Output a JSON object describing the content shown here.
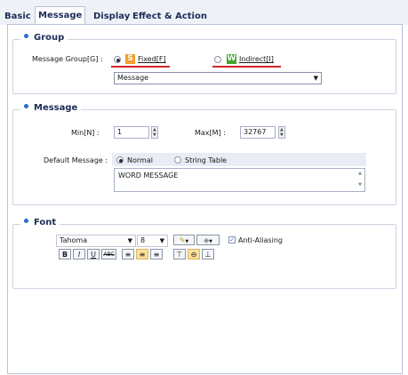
{
  "tabs": [
    {
      "label": "Basic"
    },
    {
      "label": "Message"
    },
    {
      "label": "Display"
    },
    {
      "label": "Effect & Action"
    }
  ],
  "group": {
    "title": "Group",
    "message_group_label": "Message Group[G] :",
    "fixed_label": "Fixed[F]",
    "fixed_badge": "S",
    "indirect_label": "Indirect[I]",
    "indirect_badge": "W",
    "selected_option": "Fixed",
    "dropdown_value": "Message"
  },
  "message": {
    "title": "Message",
    "min_label": "Min[N] :",
    "min_value": "1",
    "max_label": "Max[M] :",
    "max_value": "32767",
    "default_message_label": "Default Message :",
    "normal_label": "Normal",
    "string_table_label": "String Table",
    "selected_option": "Normal",
    "text_value": "WORD MESSAGE"
  },
  "font": {
    "title": "Font",
    "font_name": "Tahoma",
    "font_size": "8",
    "anti_aliasing_label": "Anti-Aliasing",
    "anti_aliasing_checked": true,
    "buttons": {
      "bold": "B",
      "italic": "I",
      "underline": "U",
      "strike": "ABC"
    }
  },
  "colors": {
    "accent": "#2a6bd6",
    "red_underline": "#d12424",
    "fixed_badge": "#f0a030",
    "indirect_badge": "#42a52c",
    "selected_button": "#fbe09a"
  }
}
